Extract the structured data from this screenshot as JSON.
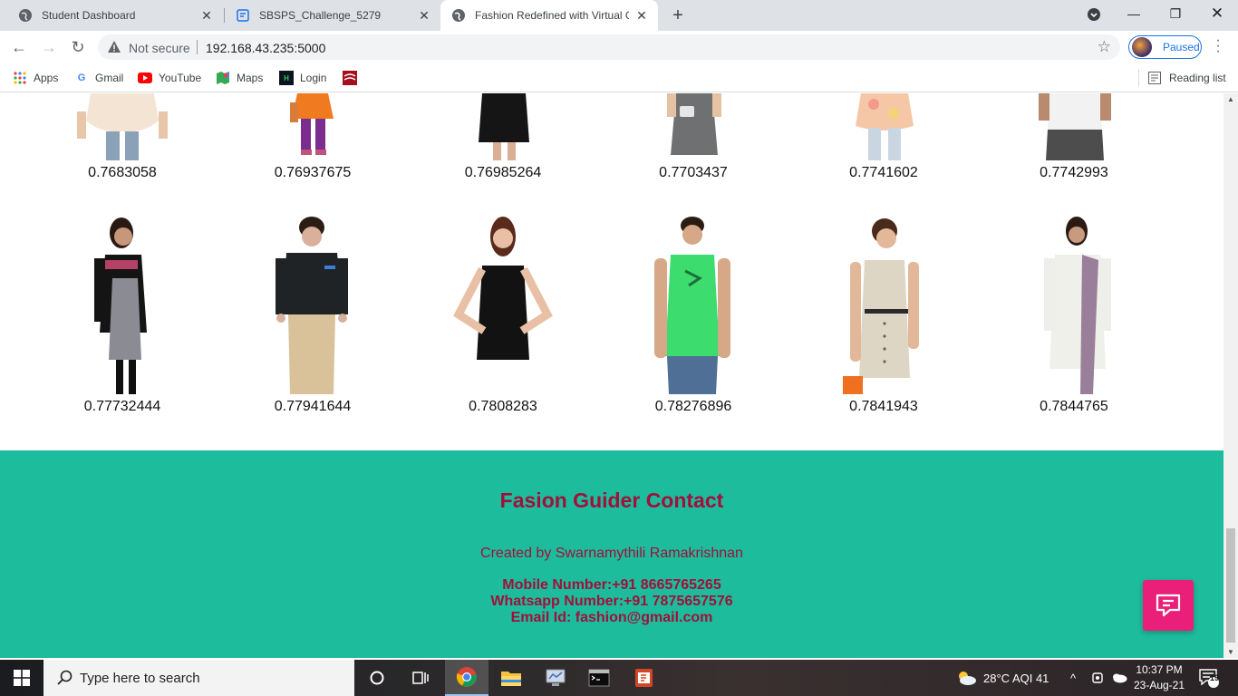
{
  "browser": {
    "tabs": [
      {
        "title": "Student Dashboard",
        "icon": "globe-icon"
      },
      {
        "title": "SBSPS_Challenge_5279",
        "icon": "doc-icon"
      },
      {
        "title": "Fashion Redefined with Virtual Gi",
        "icon": "globe-icon",
        "active": true
      }
    ],
    "new_tab_label": "+",
    "address": {
      "security_label": "Not secure",
      "url": "192.168.43.235:5000"
    },
    "profile_label": "Paused",
    "bookmarks": [
      {
        "label": "Apps",
        "icon": "apps-grid-icon"
      },
      {
        "label": "Gmail",
        "icon": "google-icon"
      },
      {
        "label": "YouTube",
        "icon": "youtube-icon"
      },
      {
        "label": "Maps",
        "icon": "maps-icon"
      },
      {
        "label": "Login",
        "icon": "hackerrank-icon"
      },
      {
        "label": "",
        "icon": "cisco-icon"
      }
    ],
    "reading_list_label": "Reading list"
  },
  "results": {
    "row1": [
      {
        "score": "0.7683058",
        "outfit": "white top jeans"
      },
      {
        "score": "0.76937675",
        "outfit": "orange kurta purple leggings"
      },
      {
        "score": "0.76985264",
        "outfit": "black dress"
      },
      {
        "score": "0.7703437",
        "outfit": "grey dress"
      },
      {
        "score": "0.7741602",
        "outfit": "floral top jeans"
      },
      {
        "score": "0.7742993",
        "outfit": "white tee grey shorts"
      }
    ],
    "row2": [
      {
        "score": "0.77732444",
        "outfit": "black grey dress"
      },
      {
        "score": "0.77941644",
        "outfit": "black shirt khaki pants"
      },
      {
        "score": "0.7808283",
        "outfit": "black sleeveless top"
      },
      {
        "score": "0.78276896",
        "outfit": "green vest jeans"
      },
      {
        "score": "0.7841943",
        "outfit": "beige dress"
      },
      {
        "score": "0.7844765",
        "outfit": "white kurta purple stole"
      }
    ]
  },
  "footer": {
    "title": "Fasion Guider Contact",
    "credit": "Created by Swarnamythili Ramakrishnan",
    "mobile": "Mobile Number:+91 8665765265",
    "whatsapp": "Whatsapp Number:+91 7875657576",
    "email": "Email Id: fashion@gmail.com"
  },
  "taskbar": {
    "search_placeholder": "Type here to search",
    "weather": "28°C  AQI 41",
    "time": "10:37 PM",
    "date": "23-Aug-21",
    "notifications": "19"
  },
  "colors": {
    "footer_bg": "#1dbc9c",
    "footer_text": "#a0103a",
    "chat_button": "#ea1f7a"
  }
}
